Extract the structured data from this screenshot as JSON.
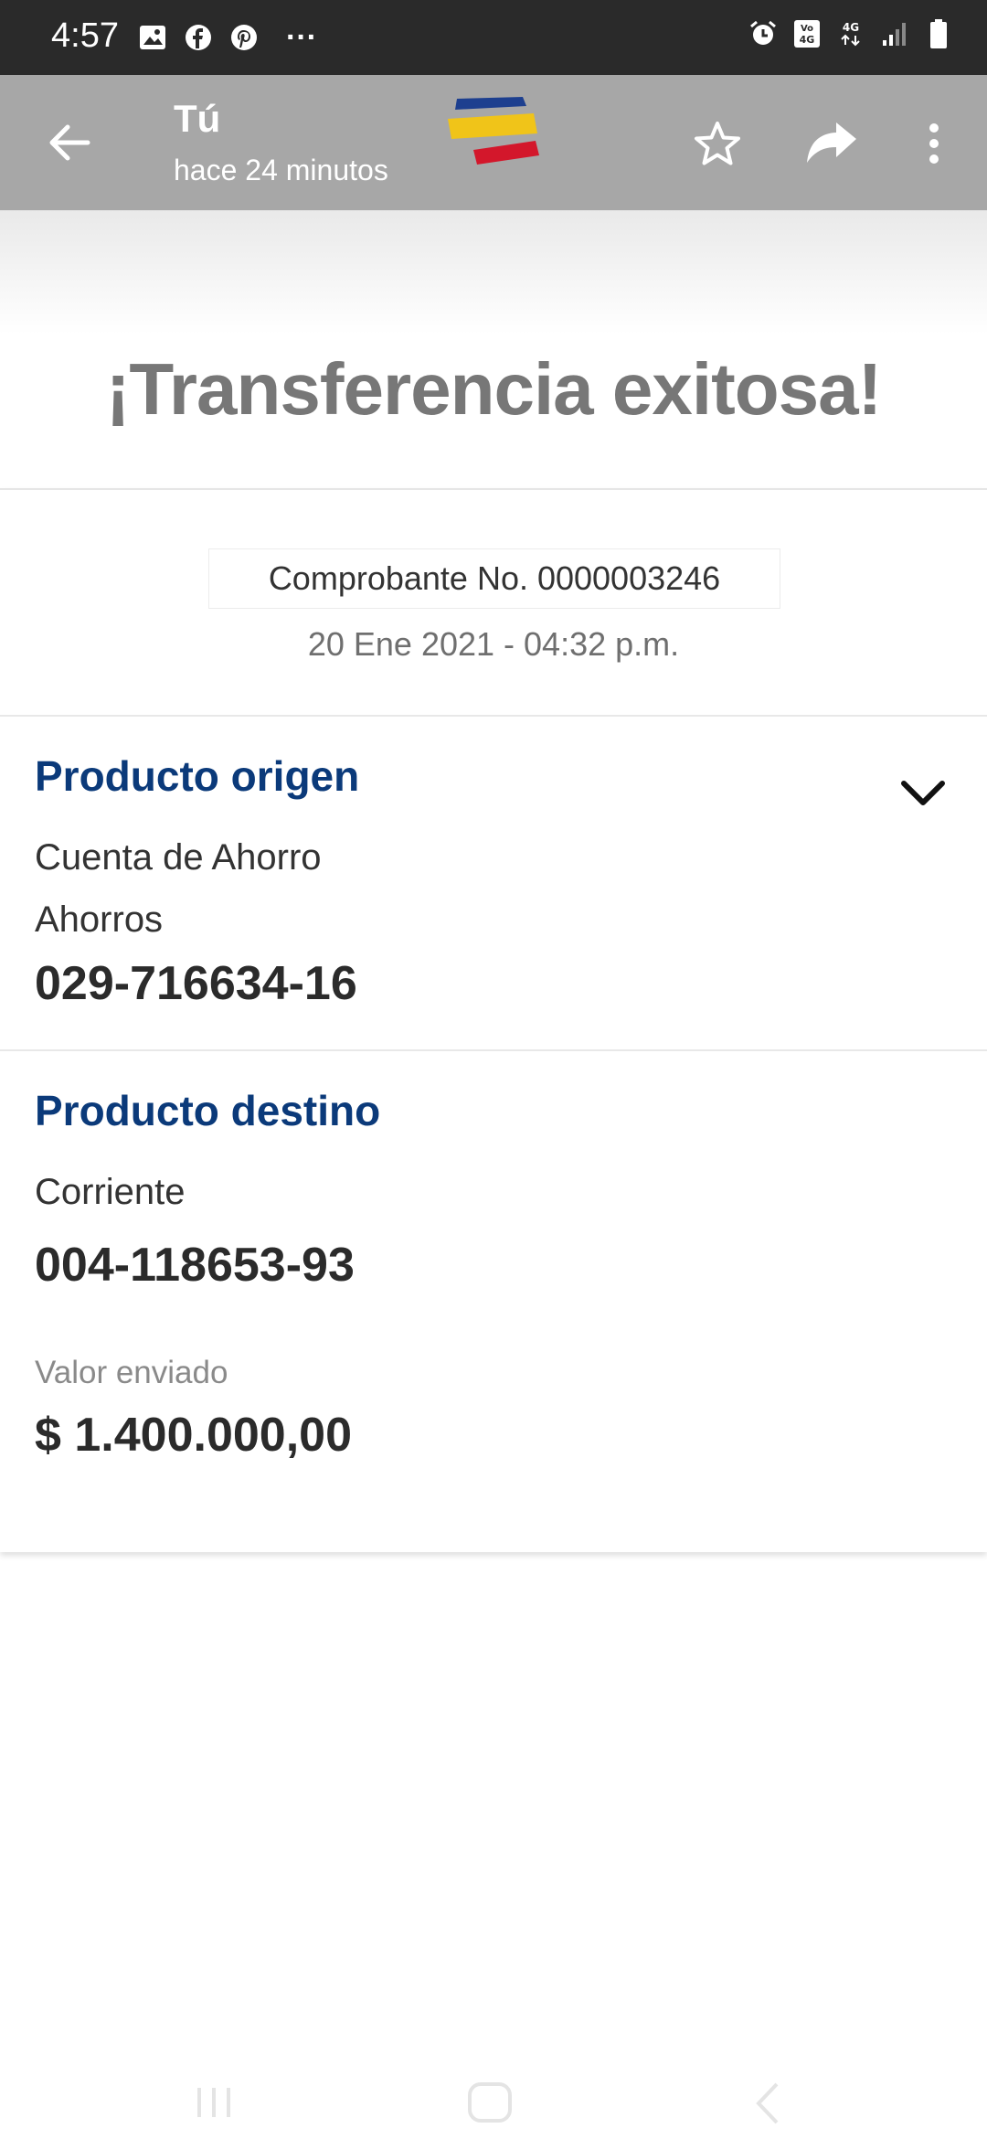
{
  "status_bar": {
    "time": "4:57",
    "left_icons": [
      "image-icon",
      "facebook-icon",
      "pinterest-icon",
      "more-dots-icon"
    ],
    "right_icons": [
      "alarm-icon",
      "volte-icon",
      "4g-icon",
      "signal-icon",
      "battery-icon"
    ],
    "more_dots": "···"
  },
  "header": {
    "sender": "Tú",
    "time_ago": "hace 24 minutos",
    "logo_colors": [
      "#1d3f8f",
      "#f0c419",
      "#d3172b"
    ]
  },
  "hero": {
    "title": "¡Transferencia exitosa!"
  },
  "receipt": {
    "number_label": "Comprobante No. 0000003246",
    "date": "20 Ene 2021 - 04:32 p.m."
  },
  "origin": {
    "title": "Producto origen",
    "type": "Cuenta de Ahorro",
    "subtype": "Ahorros",
    "number": "029-716634-16"
  },
  "destination": {
    "title": "Producto destino",
    "type": "Corriente",
    "number": "004-118653-93"
  },
  "amount": {
    "label": "Valor enviado",
    "value": "$ 1.400.000,00"
  },
  "colors": {
    "title_blue": "#0b3a7a",
    "appbar_gray": "#a7a7a7"
  }
}
